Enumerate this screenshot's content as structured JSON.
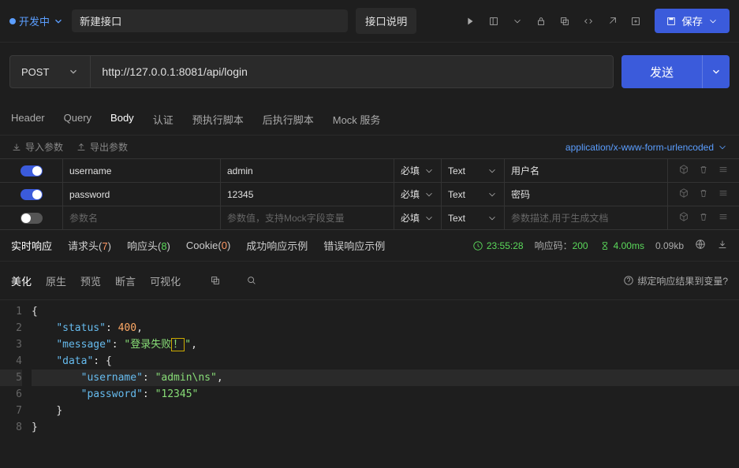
{
  "top": {
    "status": "开发中",
    "name": "新建接口",
    "doc_btn": "接口说明",
    "save_label": "保存"
  },
  "request": {
    "method": "POST",
    "url": "http://127.0.0.1:8081/api/login",
    "send": "发送"
  },
  "tabs": [
    "Header",
    "Query",
    "Body",
    "认证",
    "预执行脚本",
    "后执行脚本",
    "Mock 服务"
  ],
  "param_bar": {
    "import": "导入参数",
    "export": "导出参数",
    "content_type": "application/x-www-form-urlencoded"
  },
  "params": [
    {
      "on": true,
      "name": "username",
      "value": "admin",
      "required": "必填",
      "type": "Text",
      "desc": "用户名"
    },
    {
      "on": true,
      "name": "password",
      "value": "12345",
      "required": "必填",
      "type": "Text",
      "desc": "密码"
    }
  ],
  "param_placeholder": {
    "name": "参数名",
    "value": "参数值，支持Mock字段变量",
    "required": "必填",
    "type": "Text",
    "desc": "参数描述,用于生成文档"
  },
  "response_tabs": {
    "realtime": "实时响应",
    "req_header": "请求头",
    "req_header_n": "7",
    "resp_header": "响应头",
    "resp_header_n": "8",
    "cookie": "Cookie",
    "cookie_n": "0",
    "success": "成功响应示例",
    "error": "错误响应示例"
  },
  "resp_status": {
    "time": "23:55:28",
    "code_label": "响应码：",
    "code": "200",
    "duration": "4.00ms",
    "size": "0.09kb"
  },
  "view_tabs": [
    "美化",
    "原生",
    "预览",
    "断言",
    "可视化"
  ],
  "bind_var": "绑定响应结果到变量?",
  "code_lines": [
    "{",
    "    \"status\": 400,",
    "    \"message\": \"登录失败！\",",
    "    \"data\": {",
    "        \"username\": \"admin\\ns\",",
    "        \"password\": \"12345\"",
    "    }",
    "}"
  ]
}
